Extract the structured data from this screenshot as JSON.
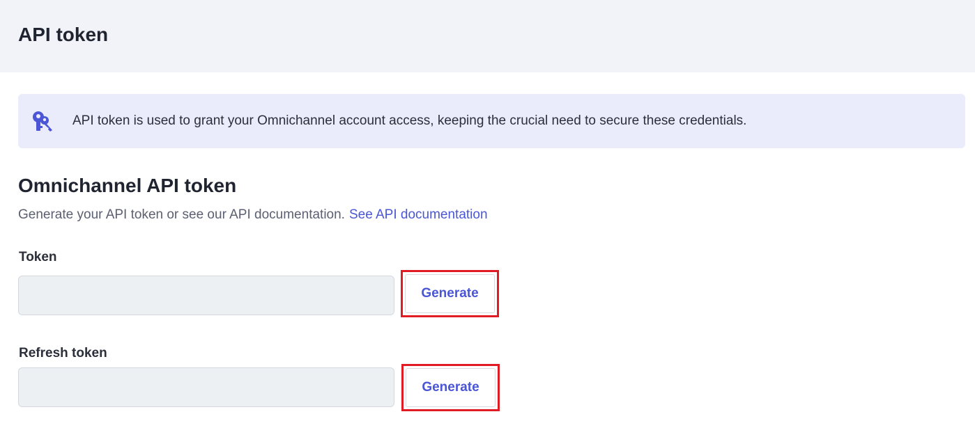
{
  "header": {
    "title": "API token"
  },
  "banner": {
    "icon": "keys-icon",
    "text": "API token is used to grant your Omnichannel account access, keeping the crucial need to secure these credentials."
  },
  "section": {
    "title": "Omnichannel API token",
    "description": "Generate your API token or see our API documentation.",
    "doc_link": "See API documentation"
  },
  "token": {
    "label": "Token",
    "value": "",
    "button_label": "Generate"
  },
  "refresh_token": {
    "label": "Refresh token",
    "value": "",
    "button_label": "Generate"
  },
  "colors": {
    "accent": "#4a56d6",
    "highlight_border": "#e01b24",
    "banner_bg": "#eaebfb",
    "header_bg": "#f1f3f9"
  }
}
